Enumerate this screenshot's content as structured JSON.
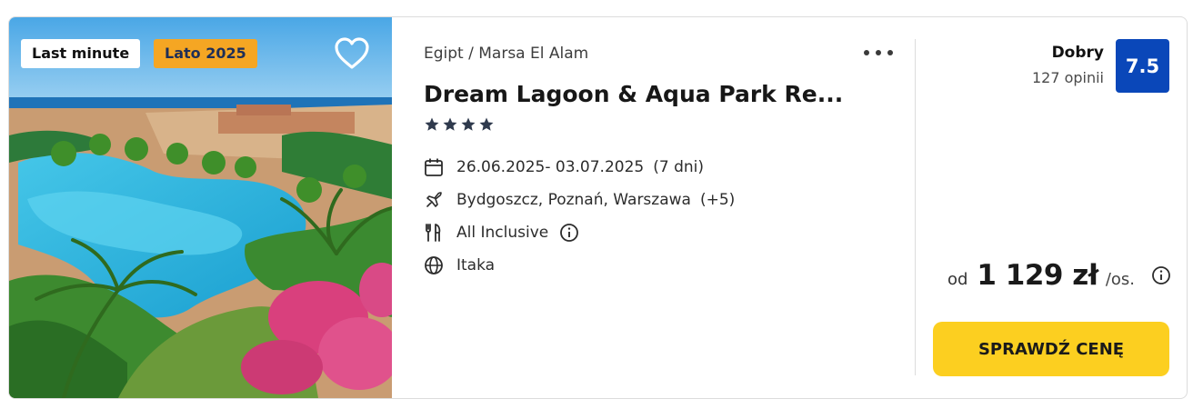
{
  "badges": {
    "last_minute": "Last minute",
    "season": "Lato 2025"
  },
  "hotel": {
    "location": "Egipt / Marsa El Alam",
    "name": "Dream Lagoon & Aqua Park Re...",
    "stars": 4
  },
  "details": {
    "dates": "26.06.2025- 03.07.2025",
    "duration": "(7 dni)",
    "departures": "Bydgoszcz, Poznań, Warszawa",
    "departures_more": "(+5)",
    "board": "All Inclusive",
    "operator": "Itaka"
  },
  "rating": {
    "label": "Dobry",
    "count": "127 opinii",
    "score": "7.5"
  },
  "price": {
    "from": "od",
    "amount": "1 129 zł",
    "per": "/os."
  },
  "cta": {
    "label": "SPRAWDŹ CENĘ"
  },
  "colors": {
    "accent": "#fccf20",
    "rating_bg": "#0a47b9",
    "season_badge": "#f5a623"
  },
  "icons": [
    "heart-icon",
    "more-icon",
    "star-icon",
    "calendar-icon",
    "plane-icon",
    "utensils-icon",
    "info-icon",
    "globe-icon"
  ]
}
